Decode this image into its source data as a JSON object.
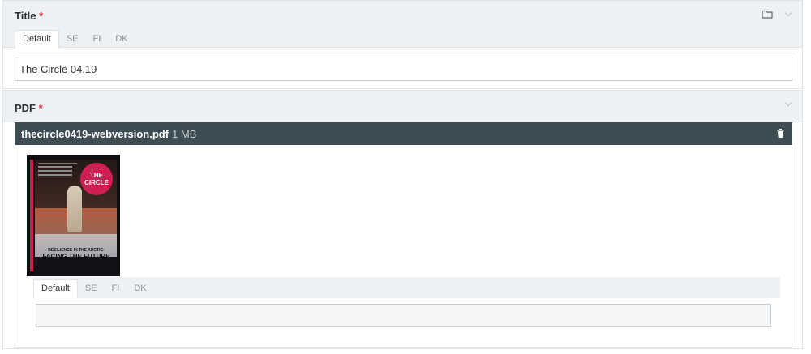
{
  "title_field": {
    "label": "Title",
    "required_mark": "*",
    "tabs": [
      {
        "label": "Default",
        "active": true
      },
      {
        "label": "SE",
        "active": false
      },
      {
        "label": "FI",
        "active": false
      },
      {
        "label": "DK",
        "active": false
      }
    ],
    "value": "The Circle 04.19",
    "icons": [
      "folder-icon",
      "chevron-down-icon"
    ]
  },
  "pdf_field": {
    "label": "PDF",
    "required_mark": "*",
    "icons": [
      "chevron-down-icon",
      "trash-icon"
    ],
    "file": {
      "name": "thecircle0419-webversion.pdf",
      "size": "1 MB"
    },
    "thumbnail": {
      "masthead": "THE CIRCLE",
      "headline_small": "RESILIENCE IN THE ARCTIC:",
      "headline_big": "FACING THE FUTURE"
    },
    "tabs": [
      {
        "label": "Default",
        "active": true
      },
      {
        "label": "SE",
        "active": false
      },
      {
        "label": "FI",
        "active": false
      },
      {
        "label": "DK",
        "active": false
      }
    ],
    "value": ""
  },
  "colors": {
    "required": "#d0323a",
    "file_bar": "#3e4c53",
    "panel_head": "#eef1f3",
    "cover_accent": "#cf1f52"
  }
}
